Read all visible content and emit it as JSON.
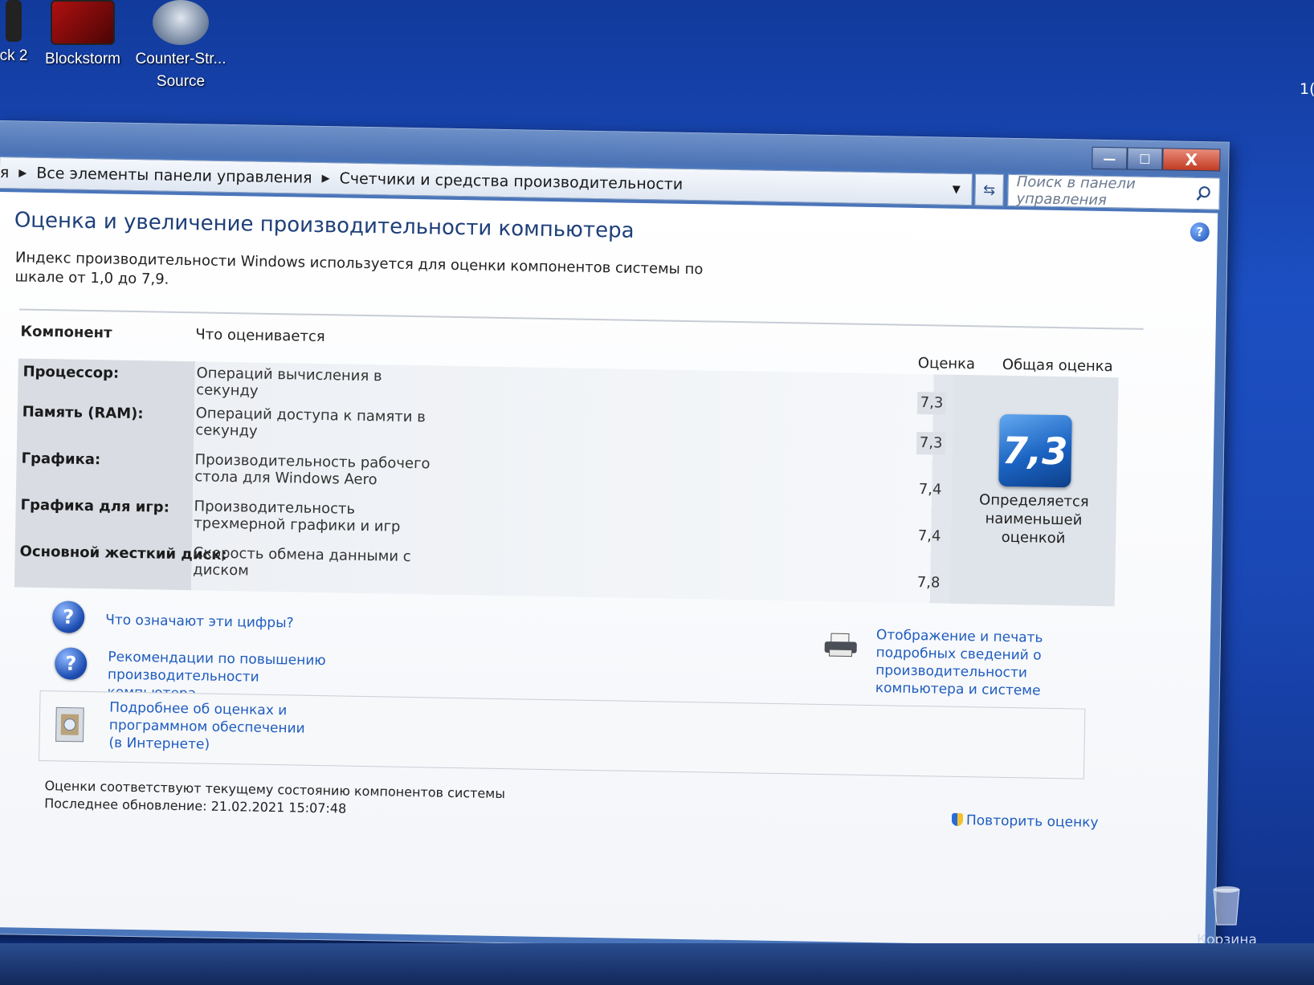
{
  "desktop": {
    "icons": [
      {
        "label": "ck 2"
      },
      {
        "label": "Blockstorm"
      },
      {
        "label": "Counter-Str...",
        "label2": "Source"
      }
    ],
    "clock_fragment": "1(",
    "recycle_label": "Корзина"
  },
  "window": {
    "breadcrumb": [
      "я",
      "Все элементы панели управления",
      "Счетчики и средства производительности"
    ],
    "search_placeholder": "Поиск в панели управления",
    "caption": {
      "min": "—",
      "max": "☐",
      "close": "X"
    }
  },
  "page": {
    "title": "Оценка и увеличение производительности компьютера",
    "description": "Индекс производительности Windows используется для оценки компонентов системы по шкале от 1,0 до 7,9.",
    "table": {
      "col_component": "Компонент",
      "col_what": "Что оценивается",
      "col_score": "Оценка",
      "col_overall": "Общая оценка",
      "rows": [
        {
          "name": "Процессор:",
          "what": "Операций вычисления в секунду",
          "score": "7,3"
        },
        {
          "name": "Память (RAM):",
          "what": "Операций доступа к памяти в секунду",
          "score": "7,3"
        },
        {
          "name": "Графика:",
          "what": "Производительность рабочего стола для Windows Aero",
          "score": "7,4"
        },
        {
          "name": "Графика для игр:",
          "what": "Производительность трехмерной графики и игр",
          "score": "7,4"
        },
        {
          "name": "Основной жесткий диск:",
          "what": "Скорость обмена данными с диском",
          "score": "7,8"
        }
      ],
      "overall_score": "7,3",
      "overall_caption": "Определяется наименьшей оценкой"
    },
    "links": {
      "what_mean": "Что означают эти цифры?",
      "recommend": "Рекомендации по повышению производительности компьютера.",
      "print": "Отображение и печать подробных сведений о производительности компьютера и системе",
      "more_info": "Подробнее об оценках и программном обеспечении (в Интернете)"
    },
    "status": {
      "line1": "Оценки соответствуют текущему состоянию компонентов системы",
      "line2": "Последнее обновление: 21.02.2021 15:07:48"
    },
    "retry": "Повторить оценку"
  }
}
